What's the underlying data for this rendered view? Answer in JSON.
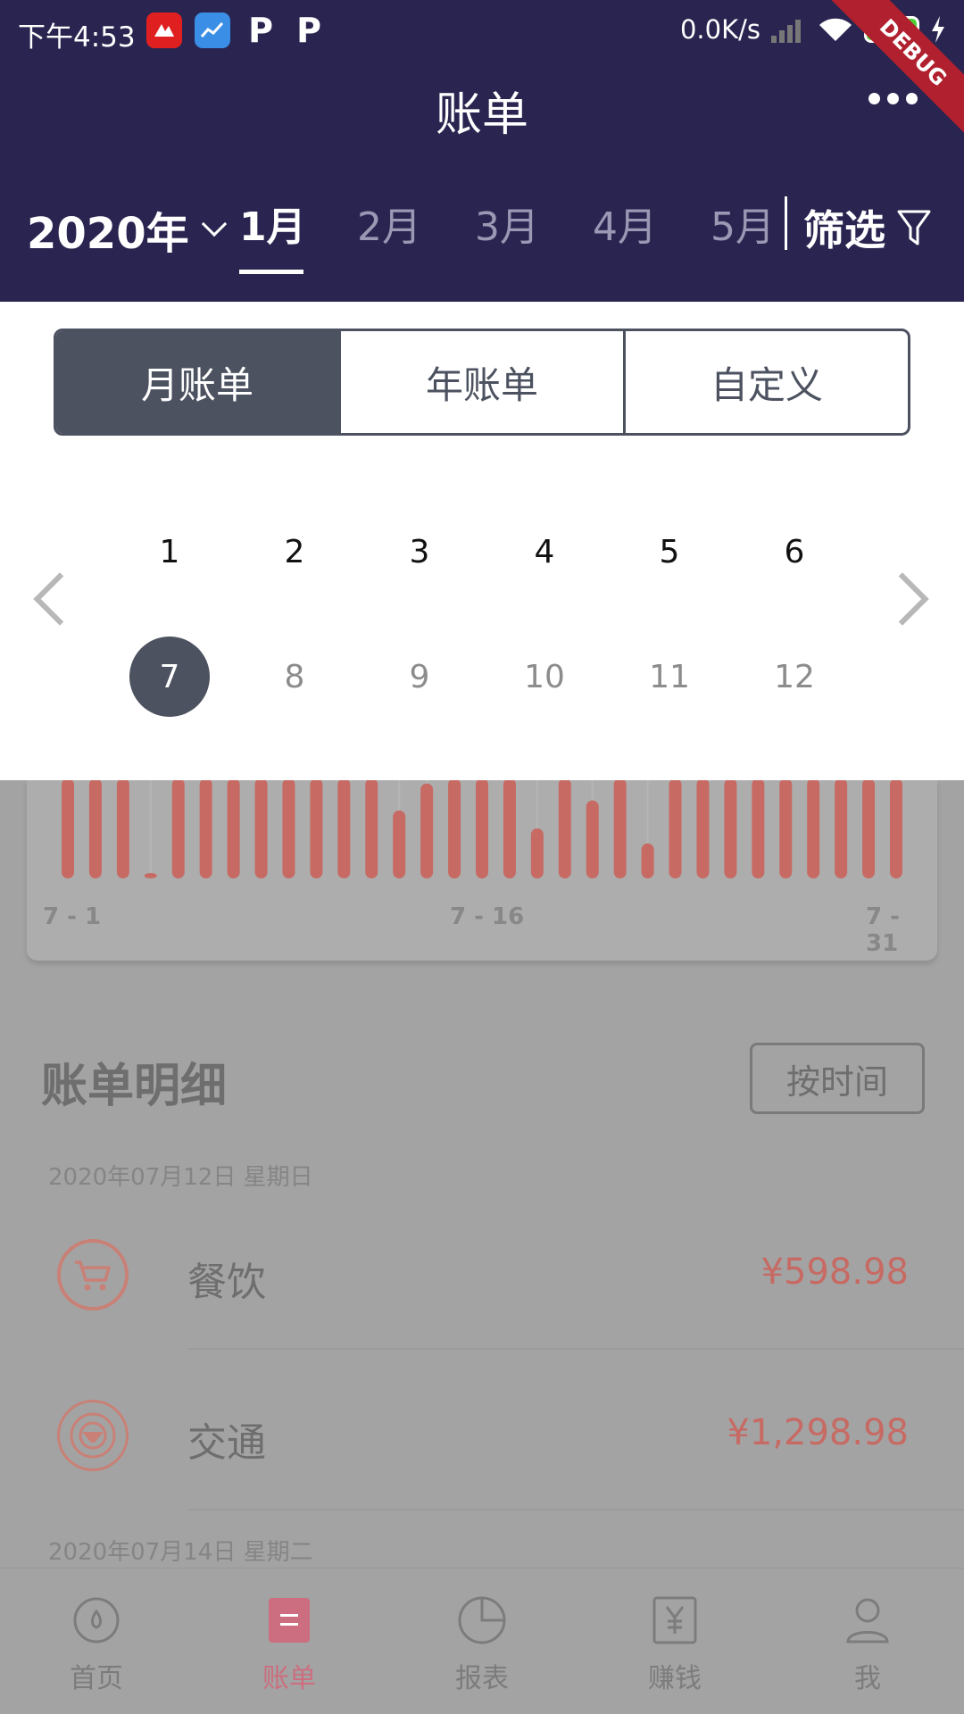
{
  "status_bar": {
    "time": "下午4:53",
    "net_speed": "0.0K/s",
    "battery": "100",
    "debug_banner": "DEBUG"
  },
  "header": {
    "title": "账单",
    "year": "2020年",
    "months": [
      "1月",
      "2月",
      "3月",
      "4月",
      "5月"
    ],
    "active_month": "1月",
    "filter_label": "筛选"
  },
  "picker": {
    "segments": [
      "月账单",
      "年账单",
      "自定义"
    ],
    "active_segment": "月账单",
    "months_row1": [
      "1",
      "2",
      "3",
      "4",
      "5",
      "6"
    ],
    "months_row2": [
      "7",
      "8",
      "9",
      "10",
      "11",
      "12"
    ],
    "selected_month": "7"
  },
  "chart_data": {
    "type": "bar",
    "x_ticks": [
      "7 - 1",
      "7 - 16",
      "7 - 31"
    ],
    "values": [
      1.0,
      1.0,
      1.0,
      0.05,
      1.0,
      1.0,
      1.0,
      1.0,
      1.0,
      1.0,
      1.0,
      1.0,
      0.68,
      0.95,
      1.0,
      1.0,
      1.0,
      0.5,
      1.0,
      0.78,
      1.0,
      0.35,
      1.0,
      1.0,
      1.0,
      1.0,
      1.0,
      1.0,
      1.0,
      1.0,
      1.0
    ],
    "bar_color": "#c76a63"
  },
  "details": {
    "title": "账单明细",
    "sort_label": "按时间",
    "groups": [
      {
        "date": "2020年07月12日 星期日",
        "items": [
          {
            "icon": "cart-icon",
            "name": "餐饮",
            "amount": "¥598.98"
          },
          {
            "icon": "steering-wheel-icon",
            "name": "交通",
            "amount": "¥1,298.98"
          }
        ]
      },
      {
        "date": "2020年07月14日 星期二",
        "items": []
      }
    ]
  },
  "tabbar": {
    "tabs": [
      {
        "label": "首页",
        "icon": "home-icon"
      },
      {
        "label": "账单",
        "icon": "bill-icon"
      },
      {
        "label": "报表",
        "icon": "pie-chart-icon"
      },
      {
        "label": "赚钱",
        "icon": "yen-icon"
      },
      {
        "label": "我",
        "icon": "user-icon"
      }
    ],
    "active": "账单"
  },
  "colors": {
    "header_bg": "#2a2550",
    "accent_dark": "#4d5260",
    "expense_red": "#c76a63",
    "active_tab": "#cc6e7f"
  }
}
